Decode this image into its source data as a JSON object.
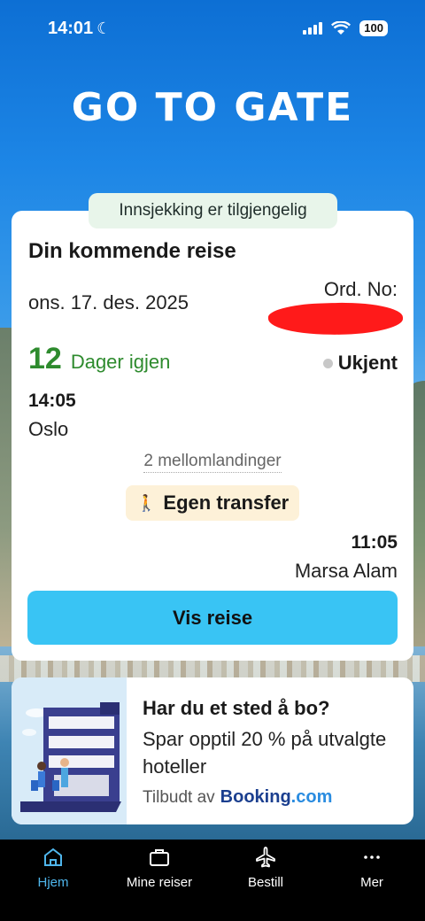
{
  "status_bar": {
    "time": "14:01",
    "battery": "100"
  },
  "logo": {
    "text": "GO TO GATE"
  },
  "trip": {
    "checkin_badge": "Innsjekking er tilgjengelig",
    "title": "Din kommende reise",
    "date": "ons. 17. des. 2025",
    "order_label": "Ord. No:",
    "days_count": "12",
    "days_label": "Dager igjen",
    "status": "Ukjent",
    "departure_time": "14:05",
    "departure_city": "Oslo",
    "stops": "2 mellomlandinger",
    "transfer": "Egen transfer",
    "arrival_time": "11:05",
    "arrival_city": "Marsa Alam",
    "view_button": "Vis reise"
  },
  "hotel_promo": {
    "title": "Har du et sted å bo?",
    "text": "Spar opptil 20 % på utvalgte hoteller",
    "offer_prefix": "Tilbudt av",
    "brand": "Booking",
    "brand_suffix": ".com"
  },
  "bottom_nav": {
    "items": [
      {
        "label": "Hjem",
        "icon": "home-icon",
        "active": true
      },
      {
        "label": "Mine reiser",
        "icon": "suitcase-icon",
        "active": false
      },
      {
        "label": "Bestill",
        "icon": "airplane-icon",
        "active": false
      },
      {
        "label": "Mer",
        "icon": "more-icon",
        "active": false
      }
    ]
  },
  "colors": {
    "accent": "#39c4f4",
    "days_green": "#2e8b2e",
    "nav_active": "#4fb6ec",
    "badge_green_bg": "#e8f5ea",
    "transfer_bg": "#fdf1d8"
  }
}
